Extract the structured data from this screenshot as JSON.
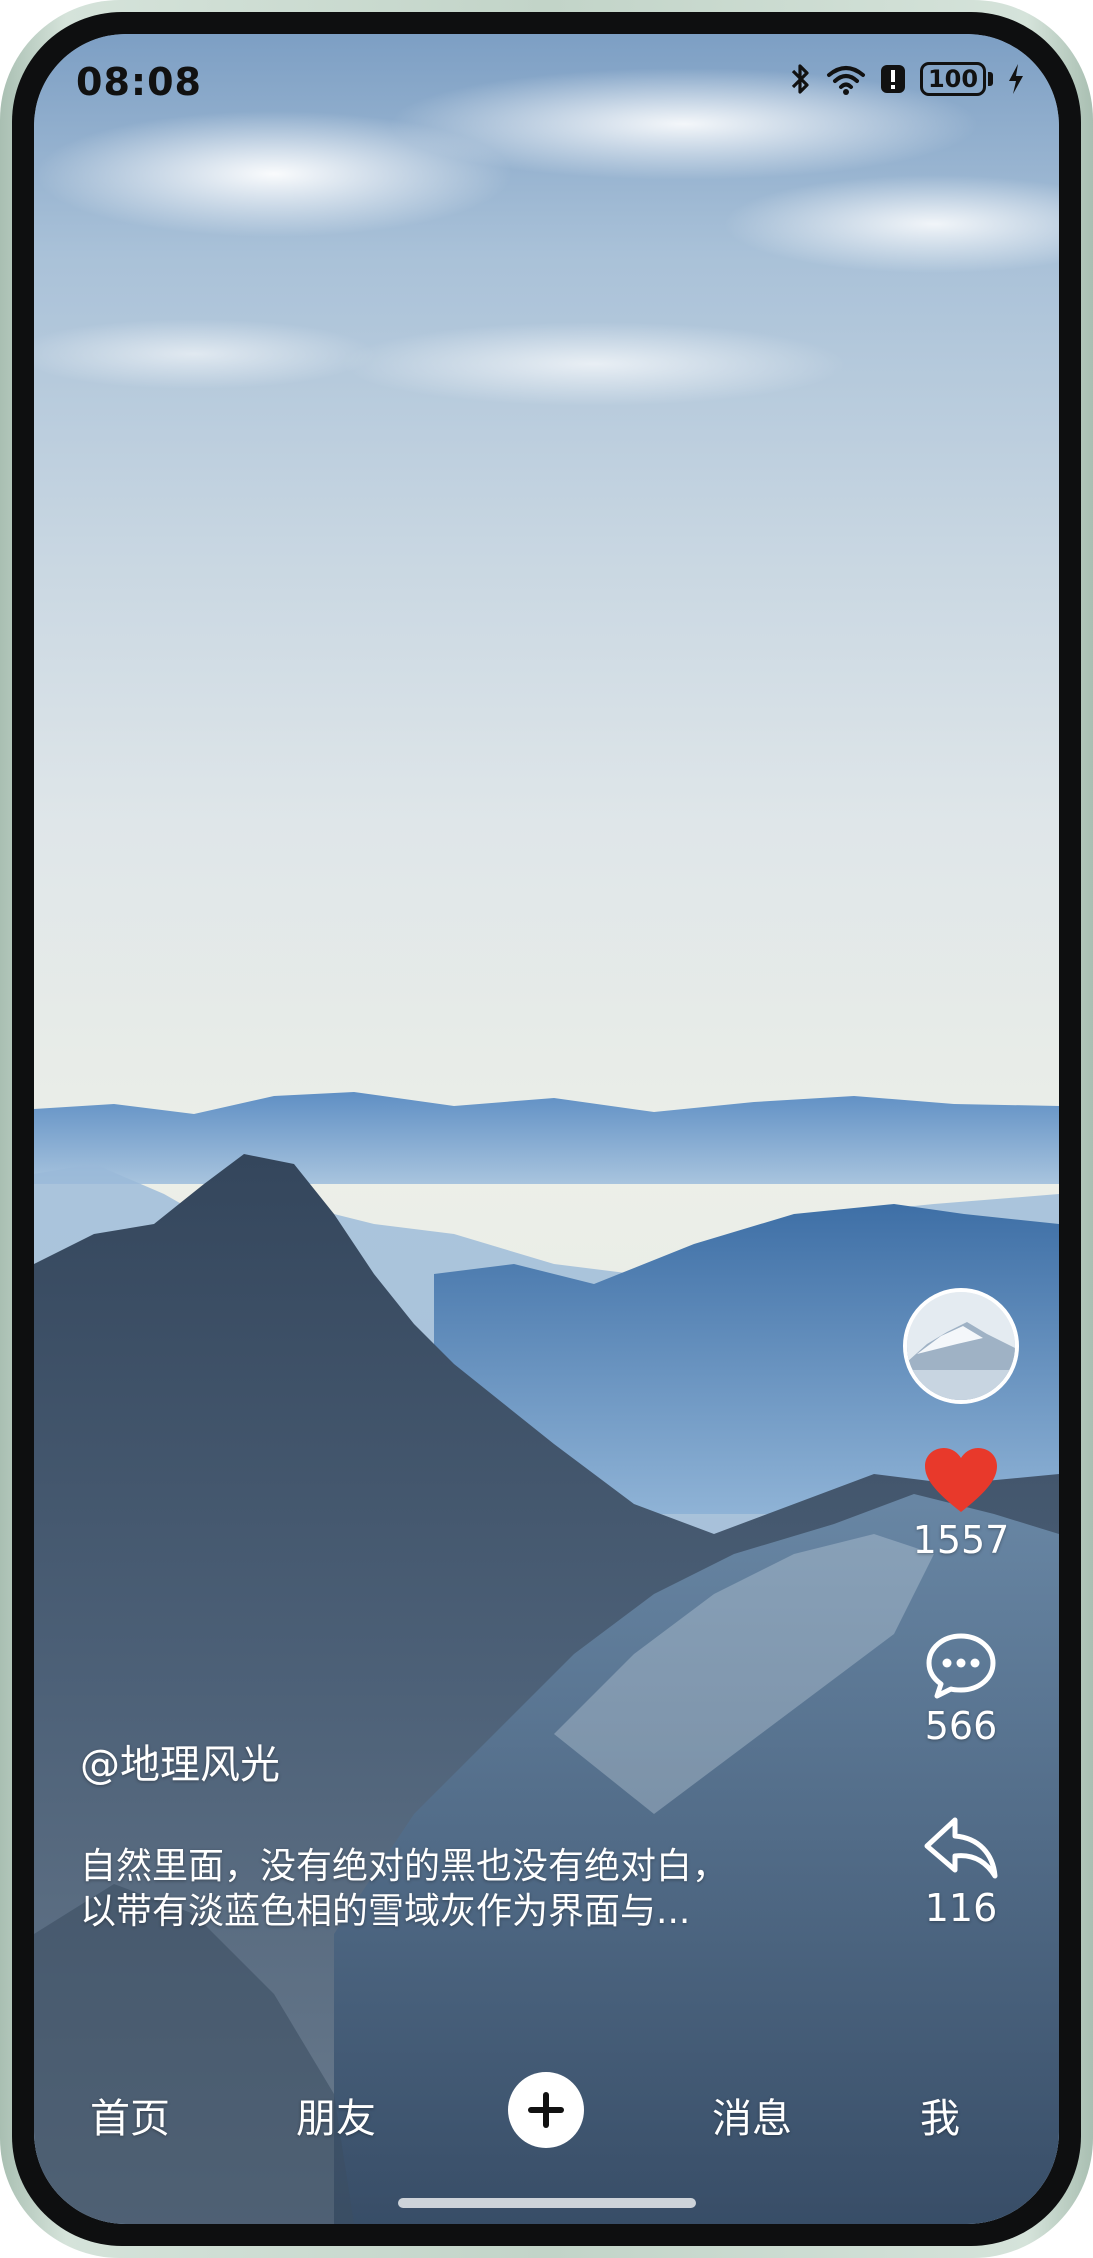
{
  "status_bar": {
    "time": "08:08",
    "icons": [
      "bluetooth-icon",
      "wifi-icon",
      "alert-icon",
      "battery-icon",
      "charging-icon"
    ],
    "battery_level": "100"
  },
  "video": {
    "author": "@地理风光",
    "caption_line1": "自然里面，没有绝对的黑也没有绝对白，",
    "caption_line2": "以带有淡蓝色相的雪域灰作为界面与..."
  },
  "actions": {
    "likes": "1557",
    "comments": "566",
    "shares": "116",
    "like_color": "#e8392b"
  },
  "bottom_nav": {
    "items": [
      {
        "label": "首页"
      },
      {
        "label": "朋友"
      },
      {
        "label": "消息"
      },
      {
        "label": "我"
      }
    ]
  }
}
